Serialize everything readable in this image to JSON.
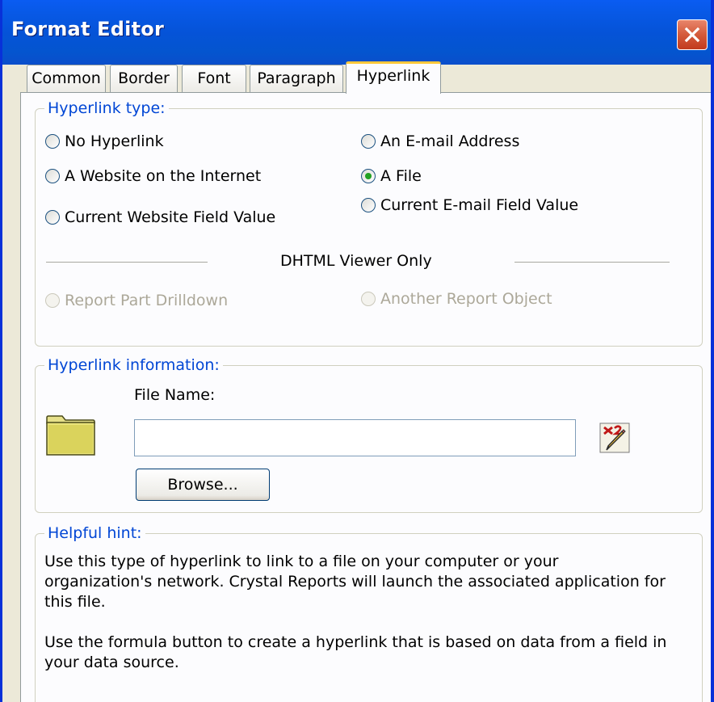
{
  "window": {
    "title": "Format Editor"
  },
  "tabs": [
    {
      "label": "Common"
    },
    {
      "label": "Border"
    },
    {
      "label": "Font"
    },
    {
      "label": "Paragraph"
    },
    {
      "label": "Hyperlink"
    }
  ],
  "active_tab": "Hyperlink",
  "hyperlink_type": {
    "legend": "Hyperlink type:",
    "options": {
      "no_hyperlink": "No Hyperlink",
      "website": "A Website on the Internet",
      "current_website_field": "Current Website Field Value",
      "email": "An E-mail Address",
      "file": "A File",
      "current_email_field": "Current E-mail Field Value"
    },
    "selected": "A File",
    "dhtml_label": "DHTML Viewer Only",
    "dhtml_options": {
      "report_part_drilldown": "Report Part Drilldown",
      "another_report_object": "Another Report Object"
    }
  },
  "hyperlink_info": {
    "legend": "Hyperlink information:",
    "file_name_label": "File Name:",
    "file_name_value": "",
    "browse_label": "Browse..."
  },
  "helpful_hint": {
    "legend": "Helpful hint:",
    "para1_line1": "Use this type of hyperlink to link to a file on your computer or your",
    "para1_line2": "organization's network. Crystal Reports will launch the associated application for",
    "para1_line3": "this file.",
    "para2_line1": "Use the formula button to create a hyperlink that is based on data from a field in",
    "para2_line2": "your data source."
  },
  "colors": {
    "titlebar": "#0A5CF2",
    "group_legend": "#0046D5",
    "selected_radio": "#21A121",
    "tab_highlight": "#FFC83C",
    "close_button": "#D45A3A"
  },
  "icons": [
    "close-icon",
    "folder-icon",
    "formula-icon"
  ]
}
